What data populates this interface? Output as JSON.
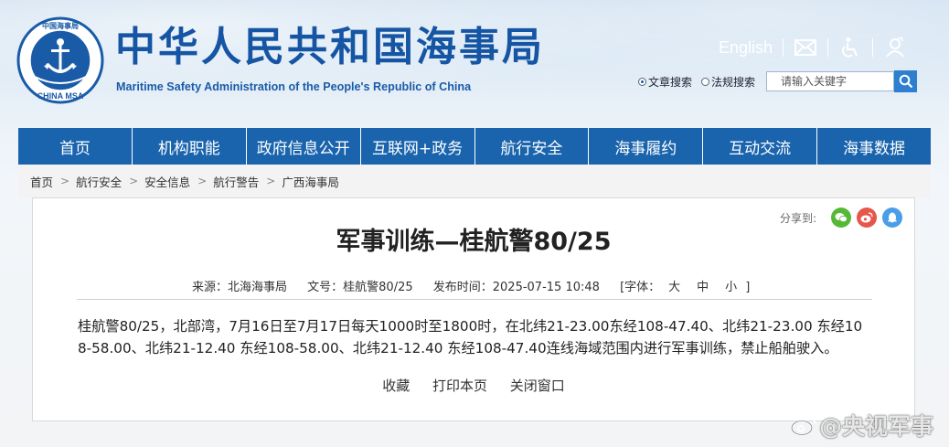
{
  "header": {
    "title": "中华人民共和国海事局",
    "subtitle": "Maritime Safety Administration of the People's Republic of China",
    "logo_text": "中国海事局 CHINA MSA",
    "lang_link": "English",
    "icons": [
      "mail-icon",
      "accessibility-icon",
      "user-icon"
    ]
  },
  "search": {
    "option_article": "文章搜索",
    "option_law": "法规搜索",
    "selected": "文章搜索",
    "placeholder": "请输入关键字"
  },
  "nav": {
    "items": [
      "首页",
      "机构职能",
      "政府信息公开",
      "互联网+政务",
      "航行安全",
      "海事履约",
      "互动交流",
      "海事数据"
    ]
  },
  "breadcrumb": [
    "首页",
    "航行安全",
    "安全信息",
    "航行警告",
    "广西海事局"
  ],
  "share": {
    "label": "分享到:",
    "icons": [
      "wechat-icon",
      "weibo-icon",
      "qq-icon"
    ],
    "colors": {
      "wechat": "#55b937",
      "weibo": "#e6564a",
      "qq": "#4a9ee8"
    }
  },
  "article": {
    "title": "军事训练—桂航警80/25",
    "source": "来源：北海海事局",
    "doc_no": "文号：桂航警80/25",
    "publish_time": "发布时间：2025-07-15 10:48",
    "font_label": "[字体：",
    "font_sizes": [
      "大",
      "中",
      "小"
    ],
    "font_close": "]",
    "body": "桂航警80/25，北部湾，7月16日至7月17日每天1000时至1800时，在北纬21-23.00东经108-47.40、北纬21-23.00 东经108-58.00、北纬21-12.40 东经108-58.00、北纬21-12.40 东经108-47.40连线海域范围内进行军事训练，禁止船舶驶入。",
    "actions": [
      "收藏",
      "打印本页",
      "关闭窗口"
    ]
  },
  "watermark": {
    "text": "@央视军事"
  },
  "colors": {
    "nav_bg": "#1a64ad",
    "title_blue": "#1555a4",
    "search_btn": "#2e7fd0"
  }
}
